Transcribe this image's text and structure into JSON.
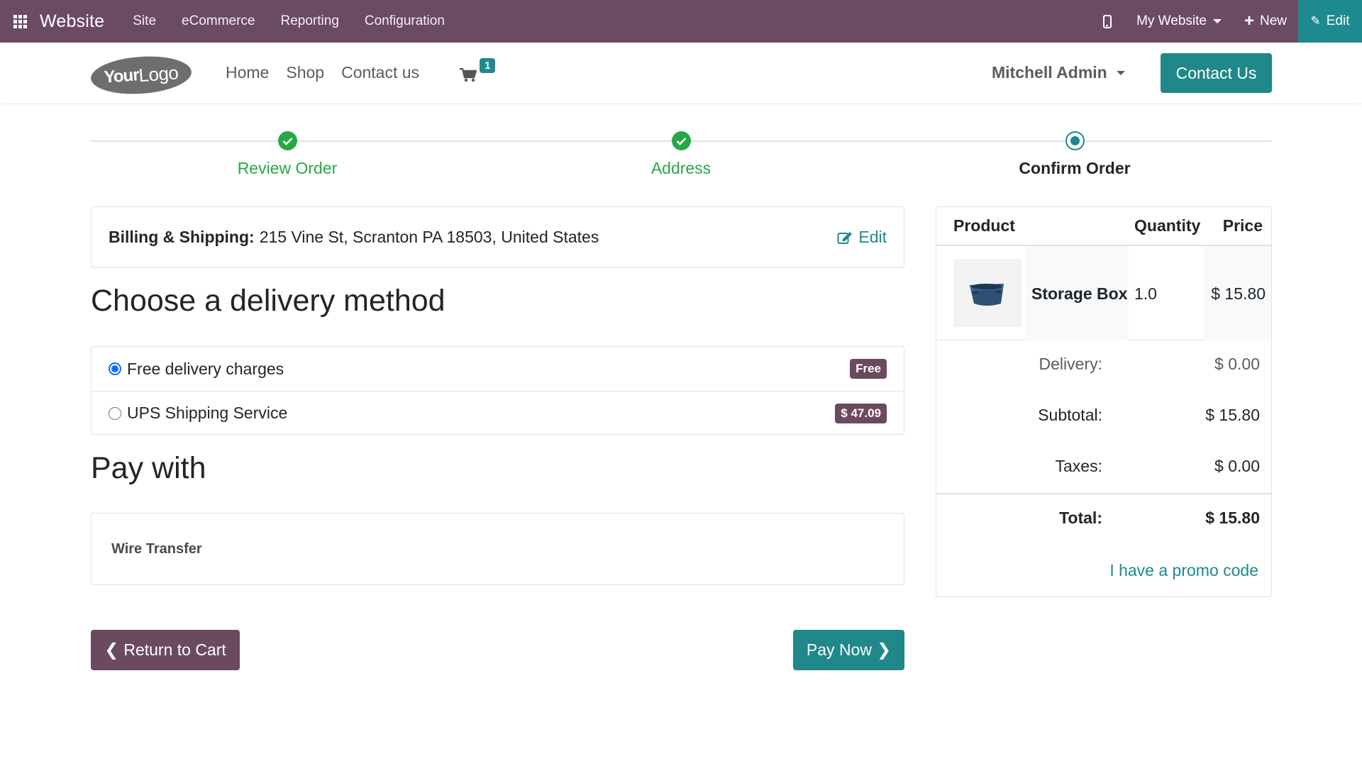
{
  "adminbar": {
    "brand": "Website",
    "menu": [
      "Site",
      "eCommerce",
      "Reporting",
      "Configuration"
    ],
    "website_selector": "My Website",
    "new_label": "New",
    "edit_label": "Edit"
  },
  "header": {
    "logo_your": "Your",
    "logo_logo": "Logo",
    "nav": [
      "Home",
      "Shop",
      "Contact us"
    ],
    "cart_count": "1",
    "user": "Mitchell Admin",
    "contact_button": "Contact Us"
  },
  "wizard": {
    "steps": [
      {
        "label": "Review Order",
        "status": "done"
      },
      {
        "label": "Address",
        "status": "done"
      },
      {
        "label": "Confirm Order",
        "status": "current"
      }
    ]
  },
  "billing": {
    "label": "Billing & Shipping:",
    "address": "215 Vine St, Scranton PA 18503, United States",
    "edit_label": "Edit"
  },
  "delivery": {
    "heading": "Choose a delivery method",
    "options": [
      {
        "label": "Free delivery charges",
        "badge": "Free",
        "selected": true
      },
      {
        "label": "UPS Shipping Service",
        "badge": "$ 47.09",
        "selected": false
      }
    ]
  },
  "payment": {
    "heading": "Pay with",
    "method": "Wire Transfer"
  },
  "buttons": {
    "return": "Return to Cart",
    "pay": "Pay Now"
  },
  "summary": {
    "headers": {
      "product": "Product",
      "quantity": "Quantity",
      "price": "Price"
    },
    "lines": [
      {
        "name": "Storage Box",
        "quantity": "1.0",
        "price": "$ 15.80",
        "icon": "storage-box-image"
      }
    ],
    "delivery_label": "Delivery:",
    "delivery_value": "$ 0.00",
    "subtotal_label": "Subtotal:",
    "subtotal_value": "$ 15.80",
    "taxes_label": "Taxes:",
    "taxes_value": "$ 0.00",
    "total_label": "Total:",
    "total_value": "$ 15.80",
    "promo": "I have a promo code"
  },
  "colors": {
    "adminbar": "#6b4a66",
    "primary_teal": "#20878a",
    "success_green": "#28a745",
    "secondary_plum": "#6b4a5f"
  }
}
